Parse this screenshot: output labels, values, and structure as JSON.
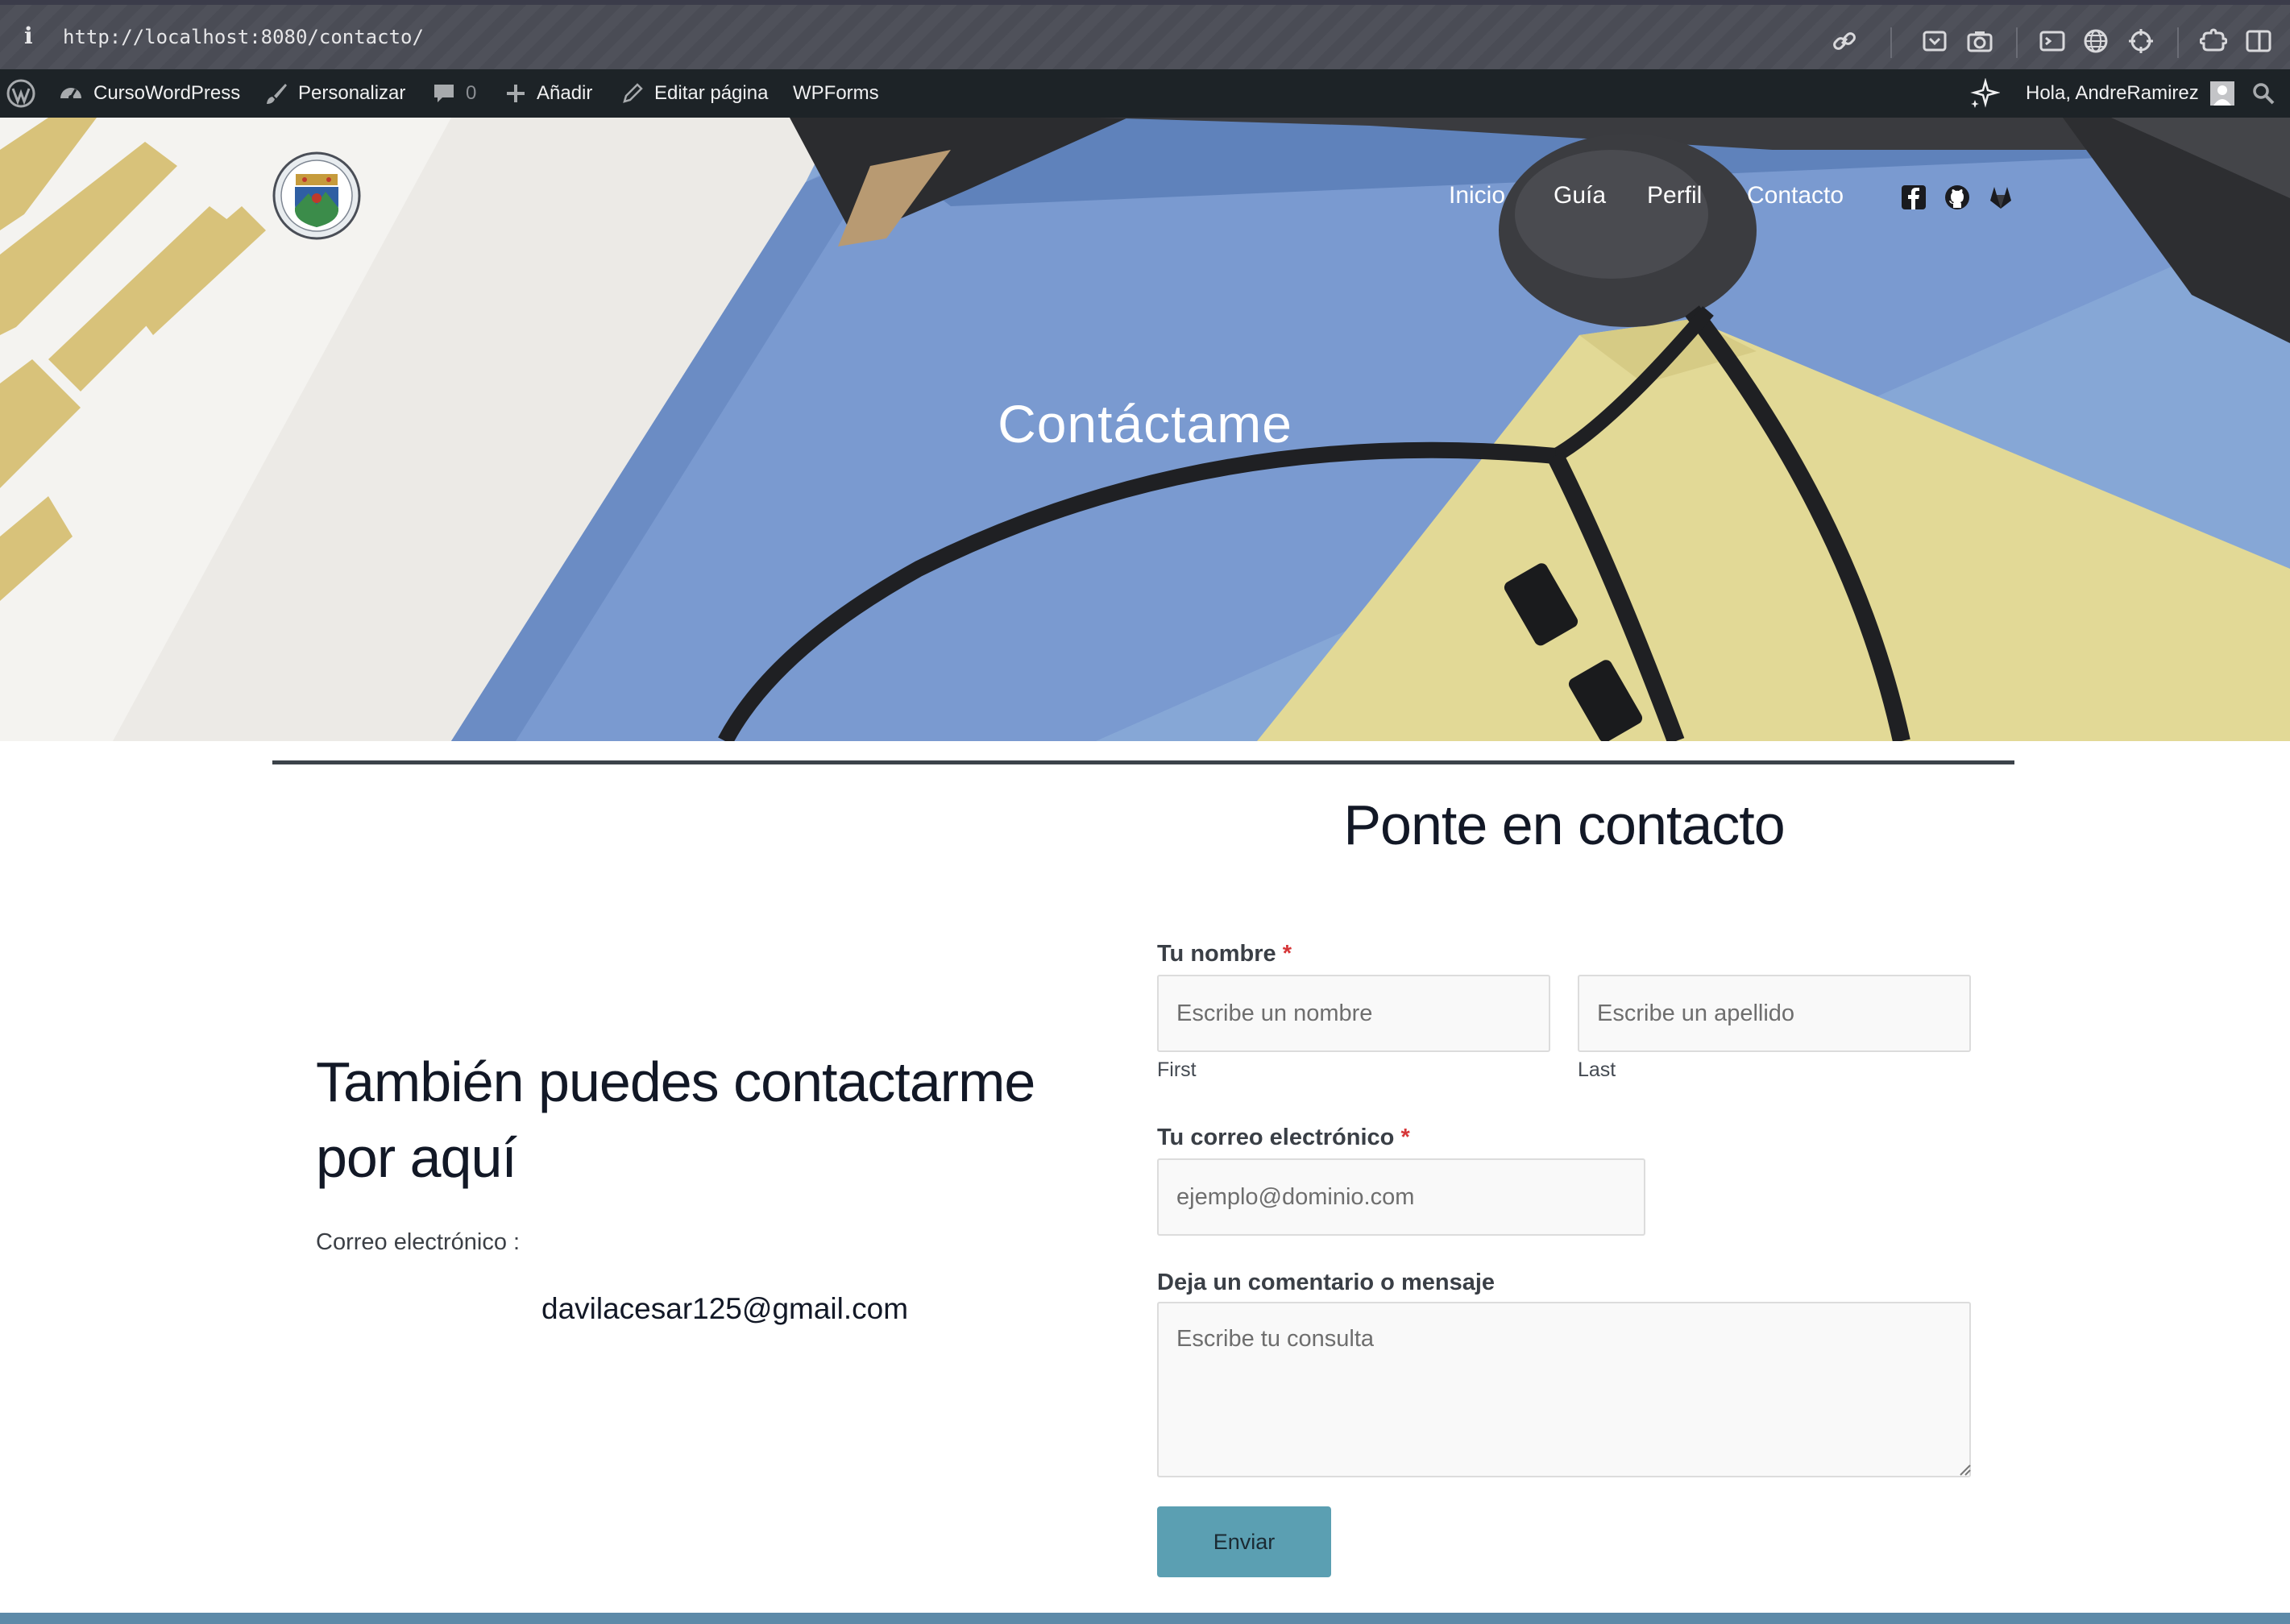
{
  "browser": {
    "info_glyph": "i",
    "url": "http://localhost:8080/contacto/"
  },
  "adminbar": {
    "site_name": "CursoWordPress",
    "customize": "Personalizar",
    "comments_count": "0",
    "new": "Añadir",
    "edit_page": "Editar página",
    "wpforms": "WPForms",
    "greeting": "Hola, AndreRamirez"
  },
  "header": {
    "nav": [
      "Inicio",
      "Guía",
      "Perfil",
      "Contacto"
    ],
    "social_icons": [
      "facebook-icon",
      "github-icon",
      "gitlab-icon"
    ]
  },
  "hero": {
    "title": "Contáctame"
  },
  "contact_info": {
    "heading": "También puedes contactarme por aquí",
    "email_label": "Correo electrónico :",
    "email": "davilacesar125@gmail.com"
  },
  "form": {
    "title": "Ponte en contacto",
    "name_label": "Tu nombre",
    "required_mark": "*",
    "first_placeholder": "Escribe un nombre",
    "last_placeholder": "Escribe un apellido",
    "first_sublabel": "First",
    "last_sublabel": "Last",
    "email_label": "Tu correo electrónico",
    "email_placeholder": "ejemplo@dominio.com",
    "message_label": "Deja un comentario o mensaje",
    "message_placeholder": "Escribe tu consulta",
    "submit_label": "Enviar"
  },
  "colors": {
    "adminbar_bg": "#1d2327",
    "accent_button": "#5b9fb2",
    "required": "#d63638",
    "footer_bar": "#5d8aa8"
  }
}
